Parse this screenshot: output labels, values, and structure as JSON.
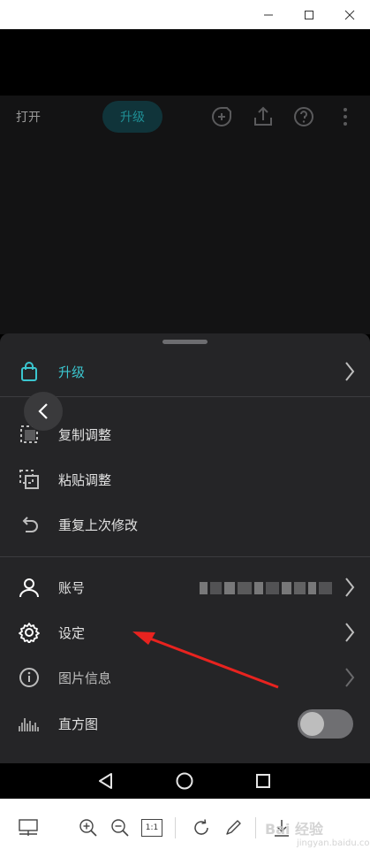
{
  "window": {
    "controls": [
      "minimize-icon",
      "maximize-icon",
      "close-icon"
    ]
  },
  "app_header": {
    "open_label": "打开",
    "upgrade_label": "升级",
    "icons": [
      "add-note-icon",
      "share-upload-icon",
      "help-icon",
      "more-vertical-icon"
    ]
  },
  "sheet": {
    "items_top": [
      {
        "label": "升级",
        "icon": "shopping-bag-icon",
        "accent": true,
        "chevron": true
      },
      {
        "label": "复制调整",
        "icon": "copy-adjust-icon",
        "accent": false,
        "chevron": false
      },
      {
        "label": "粘贴调整",
        "icon": "paste-adjust-icon",
        "accent": false,
        "chevron": false
      },
      {
        "label": "重复上次修改",
        "icon": "undo-arrow-icon",
        "accent": false,
        "chevron": false
      }
    ],
    "items_bottom": [
      {
        "label": "账号",
        "icon": "person-icon",
        "chevron": true
      },
      {
        "label": "设定",
        "icon": "gear-icon",
        "chevron": true
      },
      {
        "label": "图片信息",
        "icon": "info-icon",
        "chevron": true,
        "dimmed": true
      },
      {
        "label": "直方图",
        "icon": "histogram-icon",
        "toggle": false
      }
    ],
    "accent_color": "#3bc6cf"
  },
  "android_nav": [
    "back-triangle-icon",
    "home-circle-icon",
    "recents-square-icon"
  ],
  "toolbar": {
    "buttons": [
      "layout-icon",
      "zoom-in-icon",
      "zoom-out-icon",
      "actual-size-icon",
      "rotate-icon",
      "edit-pencil-icon",
      "download-icon"
    ],
    "actual_size_label": "1:1",
    "watermark": "Bai 经验",
    "watermark_sub": "jingyan.baidu.com"
  }
}
